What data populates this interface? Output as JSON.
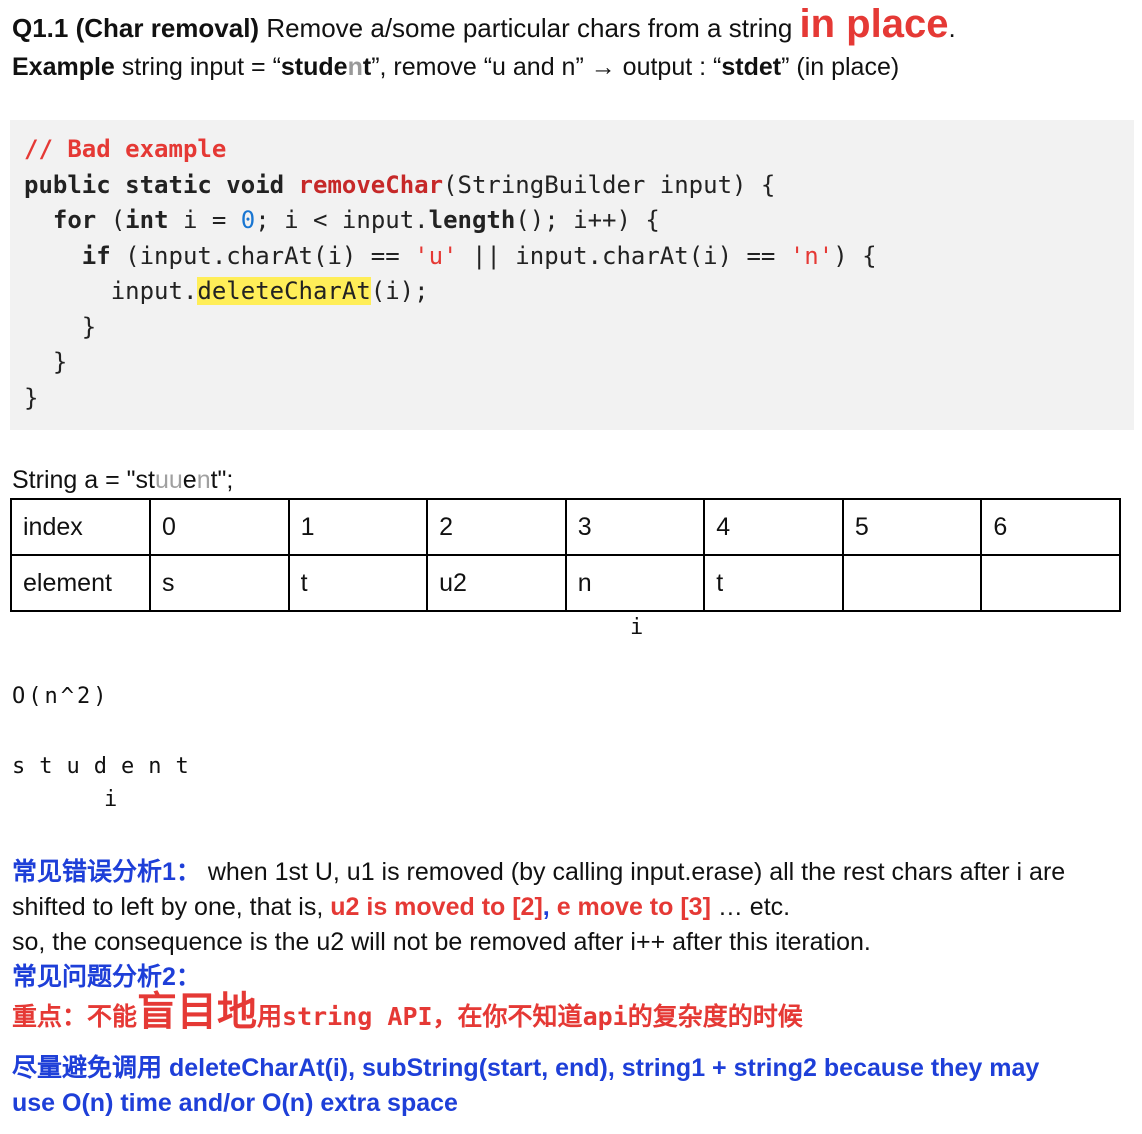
{
  "header": {
    "title_bold": "Q1.1 (Char removal)",
    "title_rest": " Remove a/some particular chars from a string ",
    "title_big": "in place",
    "title_end": ".",
    "example_label": "Example",
    "example_pre": "  string  input = “",
    "example_s1": "stu",
    "example_s2": "de",
    "example_s3": "n",
    "example_s4": "t",
    "example_mid": "”, remove “u and n”  →  output : “",
    "example_out": "stdet",
    "example_end": "” (in place)"
  },
  "code": {
    "comment": "// Bad example",
    "l2_kw": "public static void ",
    "l2_fn": "removeChar",
    "l2_rest": "(StringBuilder input) {",
    "l3_ind": "  ",
    "l3_for": "for",
    "l3_a": " (",
    "l3_int": "int",
    "l3_b": " i = ",
    "l3_zero": "0",
    "l3_c": "; i < input.",
    "l3_len": "length",
    "l3_d": "(); i++) {",
    "l4_ind": "    ",
    "l4_if": "if",
    "l4_a": " (input.charAt(i) == ",
    "l4_u": "'u'",
    "l4_b": " || input.charAt(i) == ",
    "l4_n": "'n'",
    "l4_c": ") {",
    "l5_a": "      input.",
    "l5_hl": "deleteCharAt",
    "l5_b": "(i);",
    "l6": "    }",
    "l7": "  }",
    "l8": "}"
  },
  "string_line": {
    "pre": "String a = \"st",
    "gray1": "uu",
    "mid": "e",
    "gray2": "n",
    "post": "t\";"
  },
  "table": {
    "rows": [
      [
        "index",
        "0",
        "1",
        "2",
        "3",
        "4",
        "5",
        "6"
      ],
      [
        "element",
        "s",
        "t",
        "u2",
        "n",
        "t",
        "",
        ""
      ]
    ],
    "pointer": "i"
  },
  "complexity": "O(n^2)",
  "student_chars": "student",
  "student_pointer": "i",
  "analysis": {
    "a1_label": "常见错误分析1：",
    "a1_text": "  when 1st U, u1 is removed (by calling input.erase) all the rest chars after i are",
    "a1b_pre": "shifted to left by one, that is, ",
    "a1b_red1": "u2 is moved to [2]",
    "a1b_comma": ", ",
    "a1b_red2": "e move to [3]",
    "a1b_post": " … etc.",
    "a1c": "so, the consequence is the u2 will not be removed after i++ after this iteration.",
    "a2_label": "常见问题分析2：",
    "key_a": "重点：不能",
    "key_big": "盲目地",
    "key_b": "用",
    "key_mono": "string API",
    "key_c": "，在你不知道",
    "key_mono2": "api",
    "key_d": "的复杂度的时候",
    "avoid_1": "尽量避免调用 deleteCharAt(i), subString(start, end), string1 + string2 because they may",
    "avoid_2": "use O(n) time and/or O(n) extra space"
  },
  "colors": {
    "red": "#e53935",
    "blue": "#1e3fd8",
    "highlight": "#ffee58",
    "code_bg": "#f2f2f2"
  }
}
